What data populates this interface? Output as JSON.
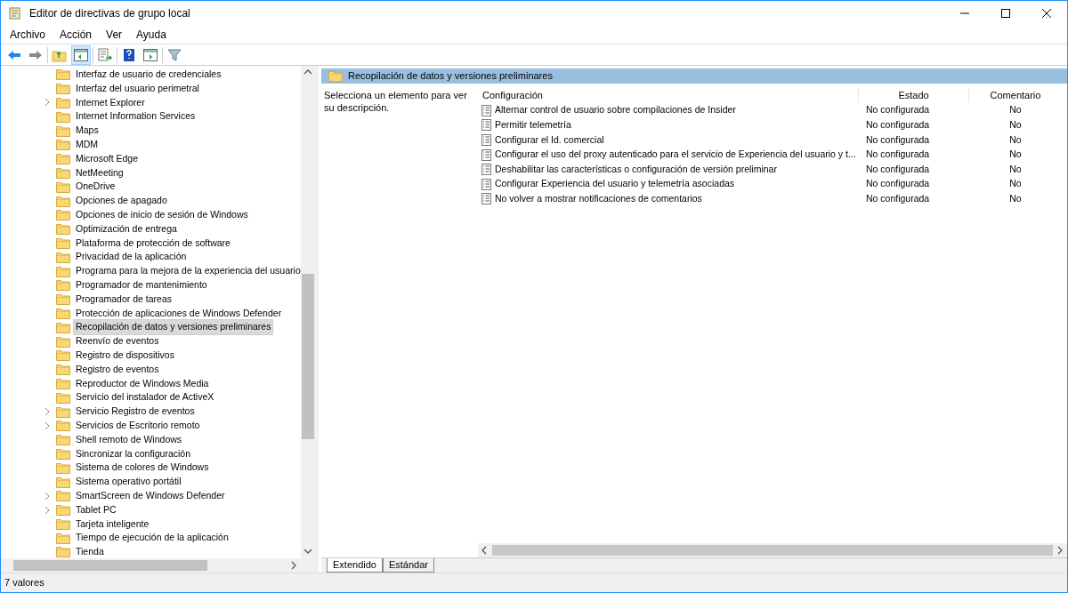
{
  "window": {
    "title": "Editor de directivas de grupo local"
  },
  "menu": [
    "Archivo",
    "Acción",
    "Ver",
    "Ayuda"
  ],
  "tree": {
    "items": [
      {
        "label": "Interfaz de usuario de credenciales",
        "expandable": false,
        "selected": false
      },
      {
        "label": "Interfaz del usuario perimetral",
        "expandable": false,
        "selected": false
      },
      {
        "label": "Internet Explorer",
        "expandable": true,
        "selected": false
      },
      {
        "label": "Internet Information Services",
        "expandable": false,
        "selected": false
      },
      {
        "label": "Maps",
        "expandable": false,
        "selected": false
      },
      {
        "label": "MDM",
        "expandable": false,
        "selected": false
      },
      {
        "label": "Microsoft Edge",
        "expandable": false,
        "selected": false
      },
      {
        "label": "NetMeeting",
        "expandable": false,
        "selected": false
      },
      {
        "label": "OneDrive",
        "expandable": false,
        "selected": false
      },
      {
        "label": "Opciones de apagado",
        "expandable": false,
        "selected": false
      },
      {
        "label": "Opciones de inicio de sesión de Windows",
        "expandable": false,
        "selected": false
      },
      {
        "label": "Optimización de entrega",
        "expandable": false,
        "selected": false
      },
      {
        "label": "Plataforma de protección de software",
        "expandable": false,
        "selected": false
      },
      {
        "label": "Privacidad de la aplicación",
        "expandable": false,
        "selected": false
      },
      {
        "label": "Programa para la mejora de la experiencia del usuario",
        "expandable": false,
        "selected": false
      },
      {
        "label": "Programador de mantenimiento",
        "expandable": false,
        "selected": false
      },
      {
        "label": "Programador de tareas",
        "expandable": false,
        "selected": false
      },
      {
        "label": "Protección de aplicaciones de Windows Defender",
        "expandable": false,
        "selected": false
      },
      {
        "label": "Recopilación de datos y versiones preliminares",
        "expandable": false,
        "selected": true
      },
      {
        "label": "Reenvío de eventos",
        "expandable": false,
        "selected": false
      },
      {
        "label": "Registro de dispositivos",
        "expandable": false,
        "selected": false
      },
      {
        "label": "Registro de eventos",
        "expandable": false,
        "selected": false
      },
      {
        "label": "Reproductor de Windows Media",
        "expandable": false,
        "selected": false
      },
      {
        "label": "Servicio del instalador de ActiveX",
        "expandable": false,
        "selected": false
      },
      {
        "label": "Servicio Registro de eventos",
        "expandable": true,
        "selected": false
      },
      {
        "label": "Servicios de Escritorio remoto",
        "expandable": true,
        "selected": false
      },
      {
        "label": "Shell remoto de Windows",
        "expandable": false,
        "selected": false
      },
      {
        "label": "Sincronizar la configuración",
        "expandable": false,
        "selected": false
      },
      {
        "label": "Sistema de colores de Windows",
        "expandable": false,
        "selected": false
      },
      {
        "label": "Sistema operativo portátil",
        "expandable": false,
        "selected": false
      },
      {
        "label": "SmartScreen de Windows Defender",
        "expandable": true,
        "selected": false
      },
      {
        "label": "Tablet PC",
        "expandable": true,
        "selected": false
      },
      {
        "label": "Tarjeta inteligente",
        "expandable": false,
        "selected": false
      },
      {
        "label": "Tiempo de ejecución de la aplicación",
        "expandable": false,
        "selected": false
      },
      {
        "label": "Tienda",
        "expandable": false,
        "selected": false
      }
    ]
  },
  "details": {
    "header": "Recopilación de datos y versiones preliminares",
    "description": "Selecciona un elemento para ver su descripción.",
    "columns": [
      "Configuración",
      "Estado",
      "Comentario"
    ],
    "rows": [
      {
        "setting": "Alternar control de usuario sobre compilaciones de Insider",
        "state": "No configurada",
        "comment": "No"
      },
      {
        "setting": "Permitir telemetría",
        "state": "No configurada",
        "comment": "No"
      },
      {
        "setting": "Configurar el Id. comercial",
        "state": "No configurada",
        "comment": "No"
      },
      {
        "setting": "Configurar el uso del proxy autenticado para el servicio de Experiencia del usuario y t...",
        "state": "No configurada",
        "comment": "No"
      },
      {
        "setting": "Deshabilitar las características o configuración de versión preliminar",
        "state": "No configurada",
        "comment": "No"
      },
      {
        "setting": "Configurar Experiencia del usuario y telemetría asociadas",
        "state": "No configurada",
        "comment": "No"
      },
      {
        "setting": "No volver a mostrar notificaciones de comentarios",
        "state": "No configurada",
        "comment": "No"
      }
    ]
  },
  "tabs": [
    {
      "label": "Extendido",
      "selected": true
    },
    {
      "label": "Estándar",
      "selected": false
    }
  ],
  "status_bar": "7 valores"
}
